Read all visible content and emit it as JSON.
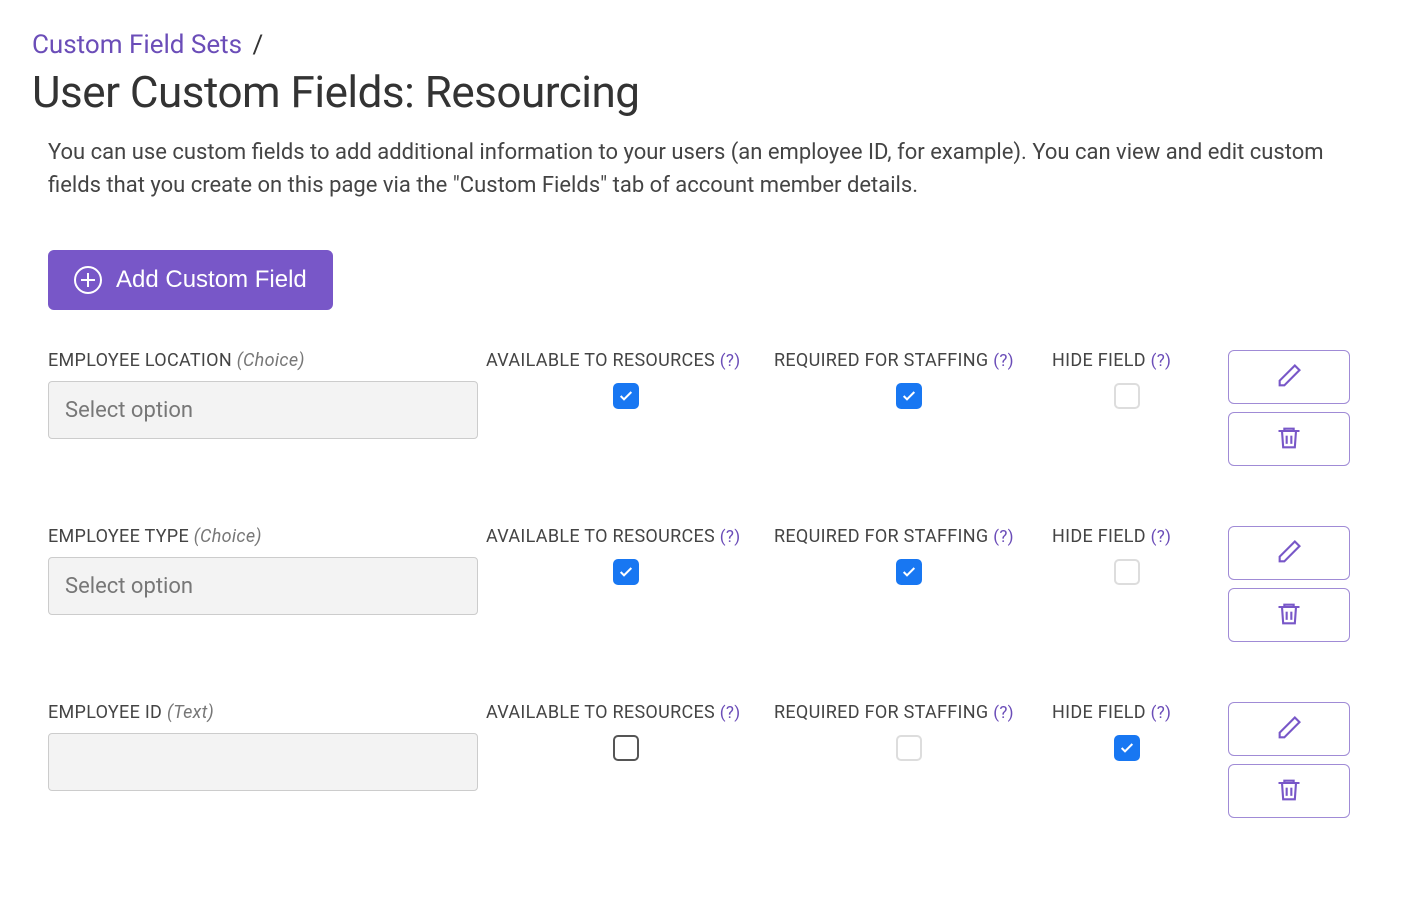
{
  "breadcrumb": {
    "parent": "Custom Field Sets",
    "separator": "/"
  },
  "page_title": "User Custom Fields: Resourcing",
  "description": "You can use custom fields to add additional information to your users (an employee ID, for example). You can view and edit custom fields that you create on this page via the \"Custom Fields\" tab of account member details.",
  "add_button_label": "Add Custom Field",
  "columns": {
    "available": "AVAILABLE TO RESOURCES",
    "required": "REQUIRED FOR STAFFING",
    "hide": "HIDE FIELD",
    "help": "(?)"
  },
  "select_placeholder": "Select option",
  "fields": [
    {
      "name": "EMPLOYEE LOCATION",
      "type_hint": "(Choice)",
      "input_kind": "select",
      "available": true,
      "required": true,
      "hide": false,
      "hide_style": "light",
      "available_style": "checked",
      "required_style": "checked"
    },
    {
      "name": "EMPLOYEE TYPE",
      "type_hint": "(Choice)",
      "input_kind": "select",
      "available": true,
      "required": true,
      "hide": false,
      "hide_style": "light",
      "available_style": "checked",
      "required_style": "checked"
    },
    {
      "name": "EMPLOYEE ID",
      "type_hint": "(Text)",
      "input_kind": "text",
      "available": false,
      "required": false,
      "hide": true,
      "hide_style": "checked",
      "available_style": "dark",
      "required_style": "light"
    }
  ]
}
